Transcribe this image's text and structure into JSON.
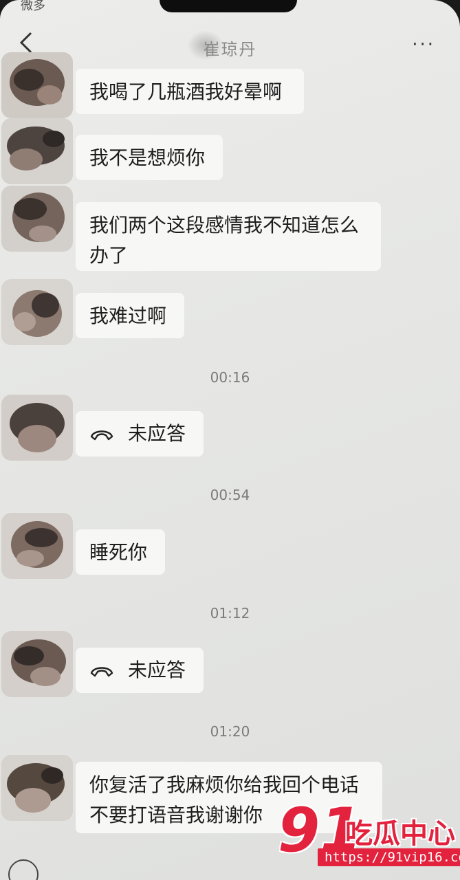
{
  "status": {
    "fragment": "微多"
  },
  "header": {
    "title": "崔琼丹",
    "more_label": "···"
  },
  "messages": [
    {
      "type": "text",
      "text": "我喝了几瓶酒我好晕啊"
    },
    {
      "type": "text",
      "text": "我不是想烦你"
    },
    {
      "type": "text",
      "text": "我们两个这段感情我不知道怎么办了"
    },
    {
      "type": "text",
      "text": "我难过啊"
    },
    {
      "type": "time",
      "text": "00:16"
    },
    {
      "type": "call",
      "text": "未应答"
    },
    {
      "type": "time",
      "text": "00:54"
    },
    {
      "type": "text",
      "text": "睡死你"
    },
    {
      "type": "time",
      "text": "01:12"
    },
    {
      "type": "call",
      "text": "未应答"
    },
    {
      "type": "time",
      "text": "01:20"
    },
    {
      "type": "text",
      "text": "你复活了我麻烦你给我回个电话不要打语音我谢谢你"
    }
  ],
  "watermark": {
    "number": "91",
    "text": "吃瓜中心",
    "url": "https://91vip16.com"
  },
  "icons": {
    "back": "chevron-left-icon",
    "call": "phone-hangup-icon",
    "voice": "voice-input-icon"
  },
  "colors": {
    "bubble": "#f7f7f6",
    "background": "#e6e7e5",
    "watermark": "#e3223d"
  }
}
